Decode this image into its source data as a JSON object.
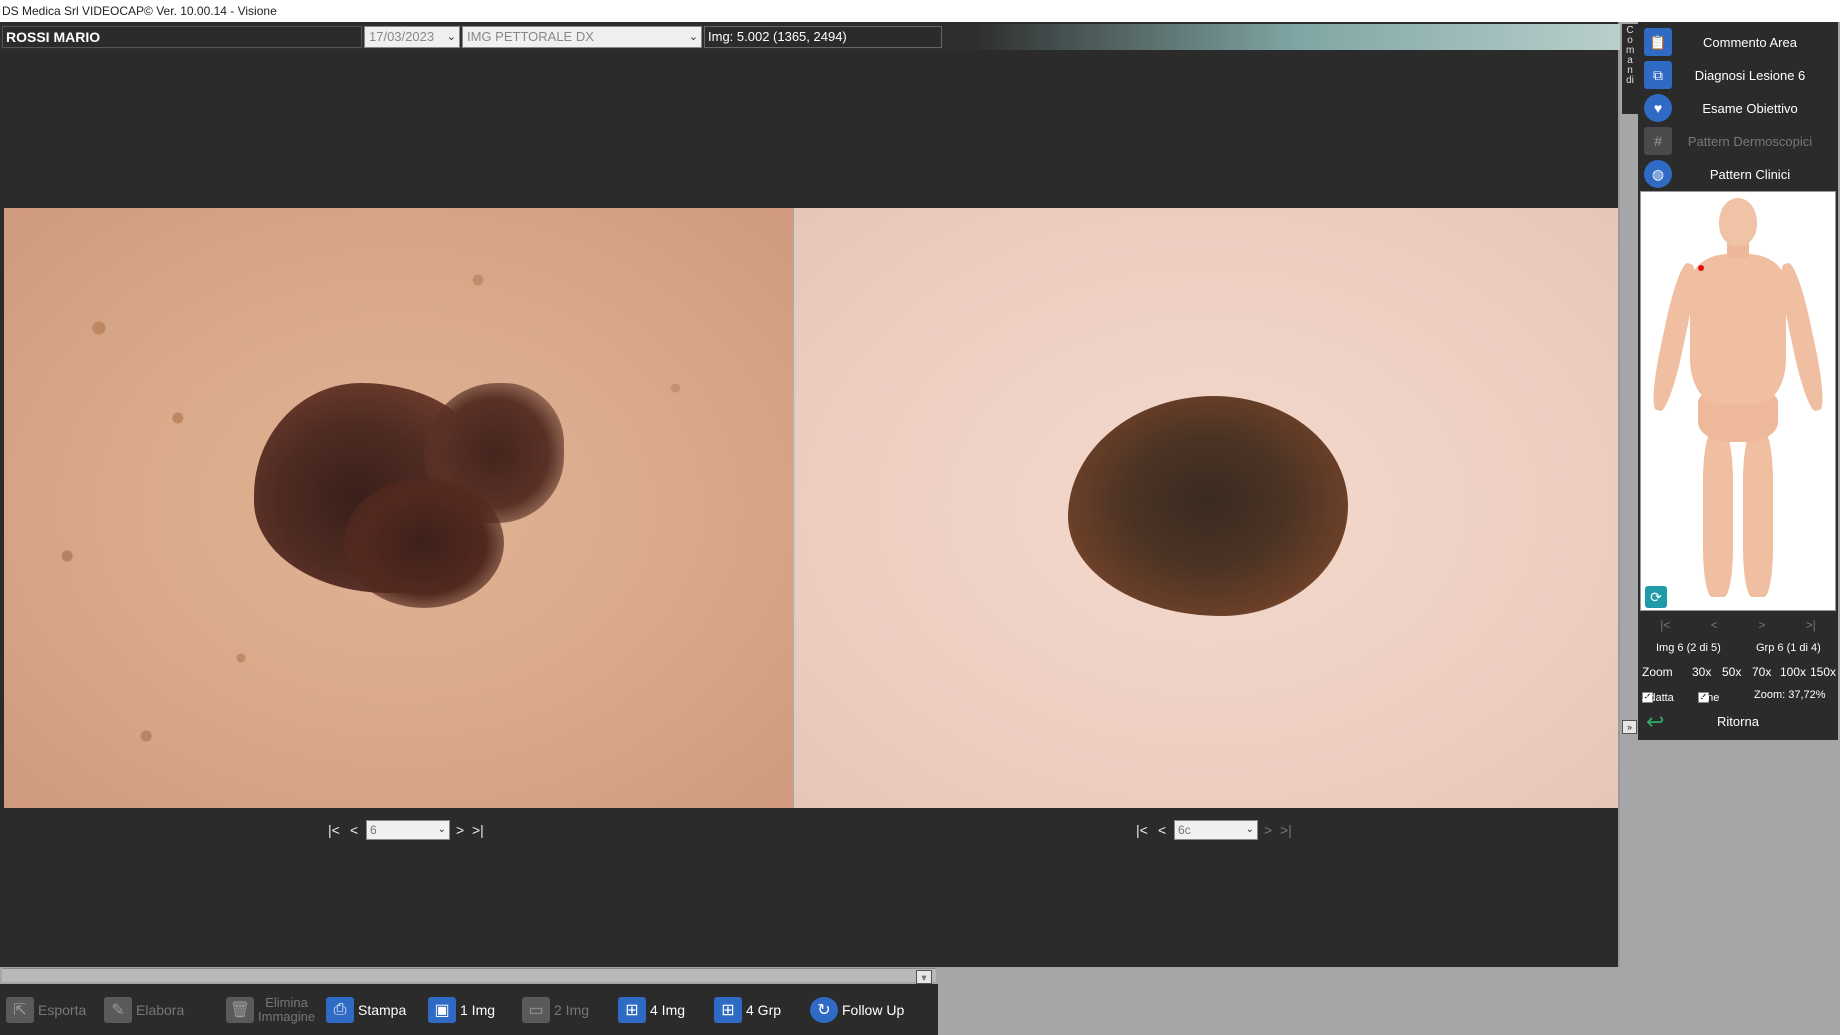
{
  "window": {
    "title": "DS Medica Srl VIDEOCAP© Ver. 10.00.14 - Visione"
  },
  "header": {
    "patient_name": "ROSSI MARIO",
    "date": "17/03/2023",
    "site": "IMG PETTORALE DX",
    "image_info": "Img: 5.002 (1365, 2494)"
  },
  "left_nav": {
    "first": "|<",
    "prev": "<",
    "value": "6",
    "next": ">",
    "last": ">|"
  },
  "right_nav": {
    "first": "|<",
    "prev": "<",
    "value": "6c",
    "next": ">",
    "last": ">|"
  },
  "toolbar": {
    "items": [
      {
        "label": "Esporta",
        "icon": "export-icon",
        "enabled": false
      },
      {
        "label": "Elabora",
        "icon": "edit-image-icon",
        "enabled": false
      },
      {
        "label1": "Elimina",
        "label2": "Immagine",
        "icon": "trash-icon",
        "enabled": false
      },
      {
        "label": "Stampa",
        "icon": "printer-icon",
        "enabled": true
      },
      {
        "label": "1 Img",
        "icon": "single-image-icon",
        "enabled": true
      },
      {
        "label": "2 Img",
        "icon": "two-images-icon",
        "enabled": false
      },
      {
        "label": "4 Img",
        "icon": "four-images-icon",
        "enabled": true
      },
      {
        "label": "4 Grp",
        "icon": "four-groups-icon",
        "enabled": true
      },
      {
        "label": "Follow Up",
        "icon": "follow-up-icon",
        "enabled": true
      }
    ],
    "collapse": "⩔"
  },
  "side_tab": {
    "label": "Comandi"
  },
  "commands": [
    {
      "label": "Commento Area",
      "icon": "clipboard-icon",
      "enabled": true
    },
    {
      "label": "Diagnosi Lesione 6",
      "icon": "diagnosis-icon",
      "enabled": true
    },
    {
      "label": "Esame Obiettivo",
      "icon": "heart-icon",
      "enabled": true
    },
    {
      "label": "Pattern Dermoscopici",
      "icon": "grid-icon",
      "enabled": false
    },
    {
      "label": "Pattern Clinici",
      "icon": "pattern-icon",
      "enabled": true
    }
  ],
  "small_nav": {
    "first": "|<",
    "prev": "<",
    "next": ">",
    "last": ">|"
  },
  "counts": {
    "img": "Img 6 (2 di 5)",
    "grp": "Grp 6 (1 di 4)"
  },
  "zoom": {
    "label": "Zoom",
    "levels": [
      "30x",
      "50x",
      "70x",
      "100x",
      "150x"
    ]
  },
  "options": {
    "adatta": "Adatta",
    "fine": "Fine",
    "zoom_value": "Zoom: 37,72%"
  },
  "ritorna": {
    "label": "Ritorna"
  },
  "colors": {
    "accent": "#2f6ac4",
    "panel_bg": "#2b2b2b",
    "marker": "#e01010"
  }
}
